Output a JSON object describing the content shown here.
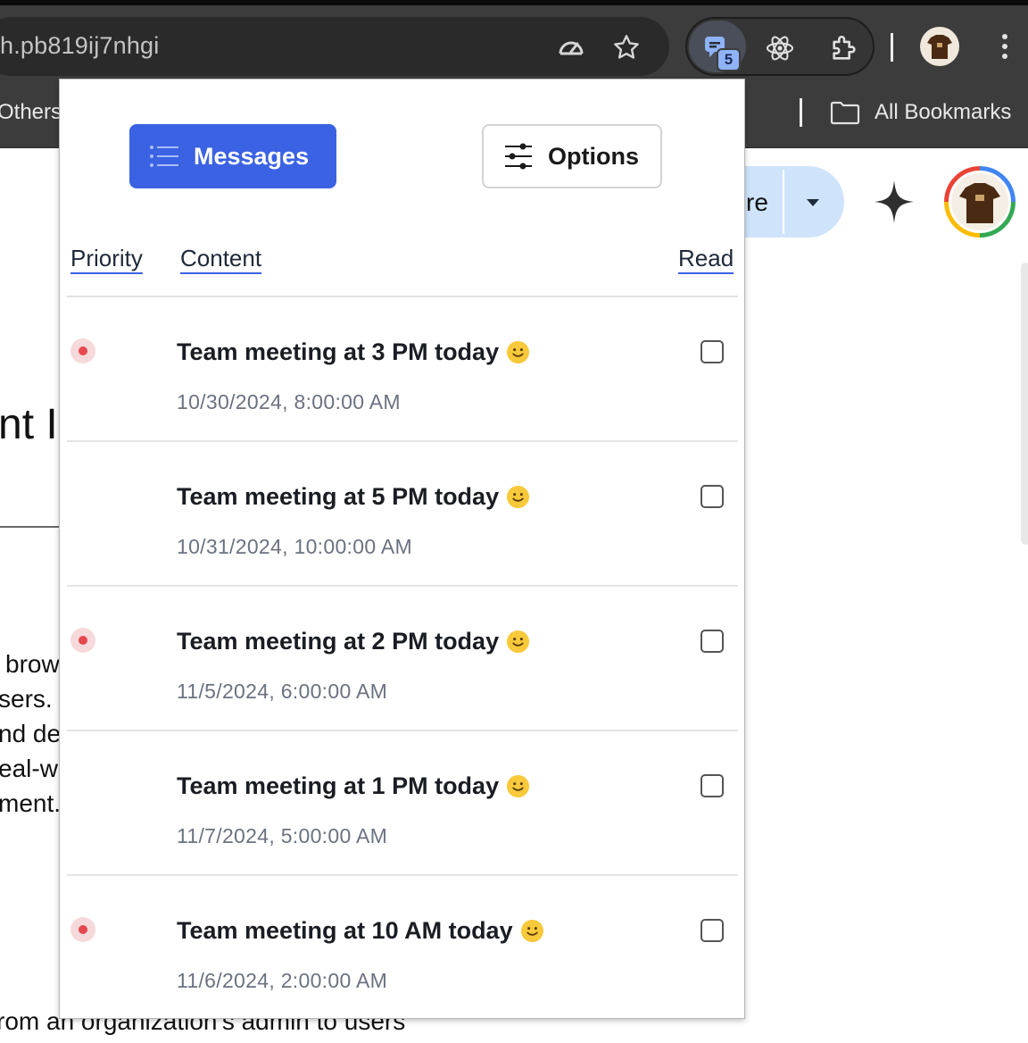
{
  "browser": {
    "url_fragment": "h.pb819ij7nhgi",
    "extension_badge_count": "5",
    "bookmarks_left": "Others",
    "bookmarks_right": "All Bookmarks",
    "icons": [
      "speedometer-icon",
      "star-icon",
      "messages-extension-icon",
      "react-devtools-icon",
      "puzzle-extensions-icon",
      "profile-avatar",
      "kebab-menu-icon",
      "folder-icon"
    ]
  },
  "underlying_page": {
    "share_fragment": "re",
    "heading_fragment": "nt I",
    "body_lines": [
      "brow",
      "sers.",
      "nd de",
      "eal-w",
      "ment."
    ],
    "bottom_line": "rom an organization's admin to users"
  },
  "popup": {
    "tabs": {
      "messages_label": "Messages",
      "options_label": "Options"
    },
    "columns": {
      "priority": "Priority",
      "content": "Content",
      "read": "Read"
    },
    "messages": [
      {
        "title": "Team meeting at 3 PM today",
        "time": "10/30/2024, 8:00:00 AM",
        "priority": true,
        "read": false
      },
      {
        "title": "Team meeting at 5 PM today",
        "time": "10/31/2024, 10:00:00 AM",
        "priority": false,
        "read": false
      },
      {
        "title": "Team meeting at 2 PM today",
        "time": "11/5/2024, 6:00:00 AM",
        "priority": true,
        "read": false
      },
      {
        "title": "Team meeting at 1 PM today",
        "time": "11/7/2024, 5:00:00 AM",
        "priority": false,
        "read": false
      },
      {
        "title": "Team meeting at 10 AM today",
        "time": "11/6/2024, 2:00:00 AM",
        "priority": true,
        "read": false
      }
    ]
  },
  "colors": {
    "accent_blue": "#3a62e3",
    "priority_red": "#e5484d",
    "chrome_dark": "#3c3c3c"
  }
}
